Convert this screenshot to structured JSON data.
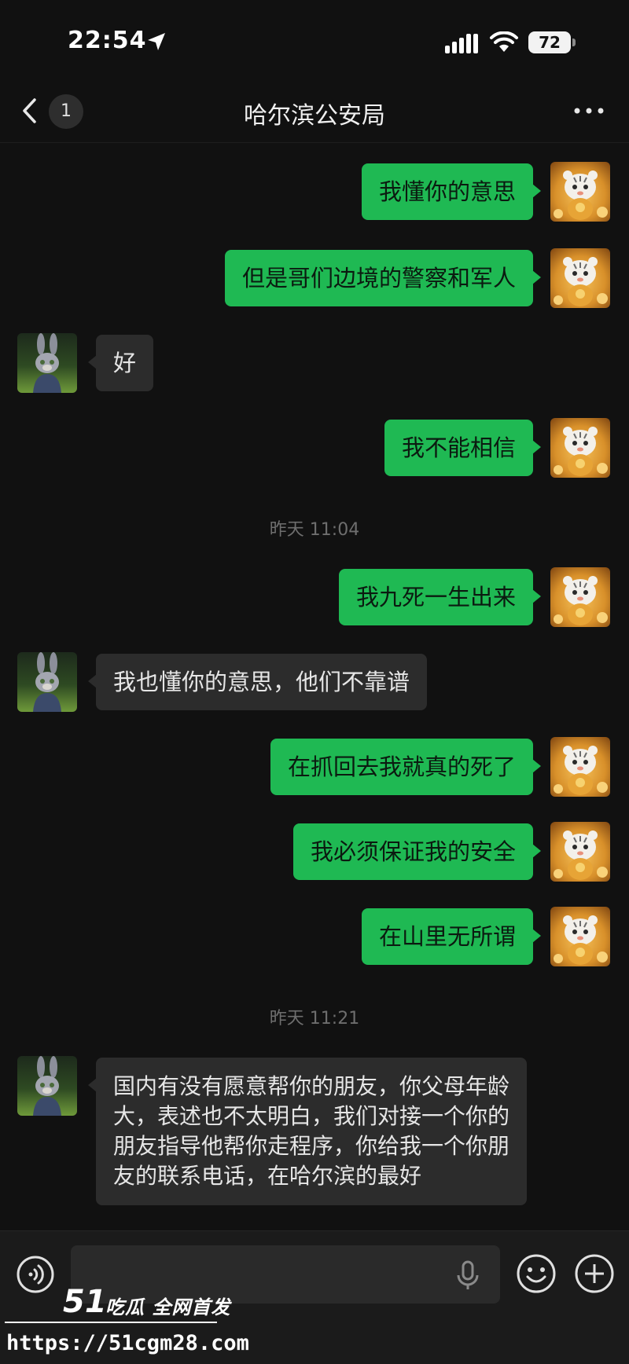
{
  "status_bar": {
    "time": "22:54",
    "battery": "72"
  },
  "header": {
    "title": "哈尔滨公安局",
    "unread_count": "1"
  },
  "messages": [
    {
      "direction": "out",
      "text": "我懂你的意思"
    },
    {
      "direction": "out",
      "text": "但是哥们边境的警察和军人"
    },
    {
      "direction": "in",
      "text": "好"
    },
    {
      "direction": "out",
      "text": "我不能相信"
    },
    {
      "timestamp": "昨天 11:04"
    },
    {
      "direction": "out",
      "text": "我九死一生出来"
    },
    {
      "direction": "in",
      "text": "我也懂你的意思，他们不靠谱"
    },
    {
      "direction": "out",
      "text": "在抓回去我就真的死了"
    },
    {
      "direction": "out",
      "text": "我必须保证我的安全"
    },
    {
      "direction": "out",
      "text": "在山里无所谓"
    },
    {
      "timestamp": "昨天 11:21"
    },
    {
      "direction": "in",
      "text": "国内有没有愿意帮你的朋友，你父母年龄大，表述也不太明白，我们对接一个你的朋友指导他帮你走程序，你给我一个你朋友的联系电话，在哈尔滨的最好"
    }
  ],
  "input": {
    "value": "",
    "placeholder": ""
  },
  "watermark": {
    "number": "51",
    "title": "吃瓜 全网首发",
    "url": "https://51cgm28.com"
  },
  "icons": {
    "back": "chevron-left-icon",
    "more": "more-dots-icon",
    "voice": "voice-icon",
    "mic": "microphone-icon",
    "emoji": "emoji-icon",
    "plus": "plus-icon"
  },
  "colors": {
    "outgoing_bubble": "#1fb953",
    "incoming_bubble": "#2c2c2c",
    "background": "#111111"
  }
}
